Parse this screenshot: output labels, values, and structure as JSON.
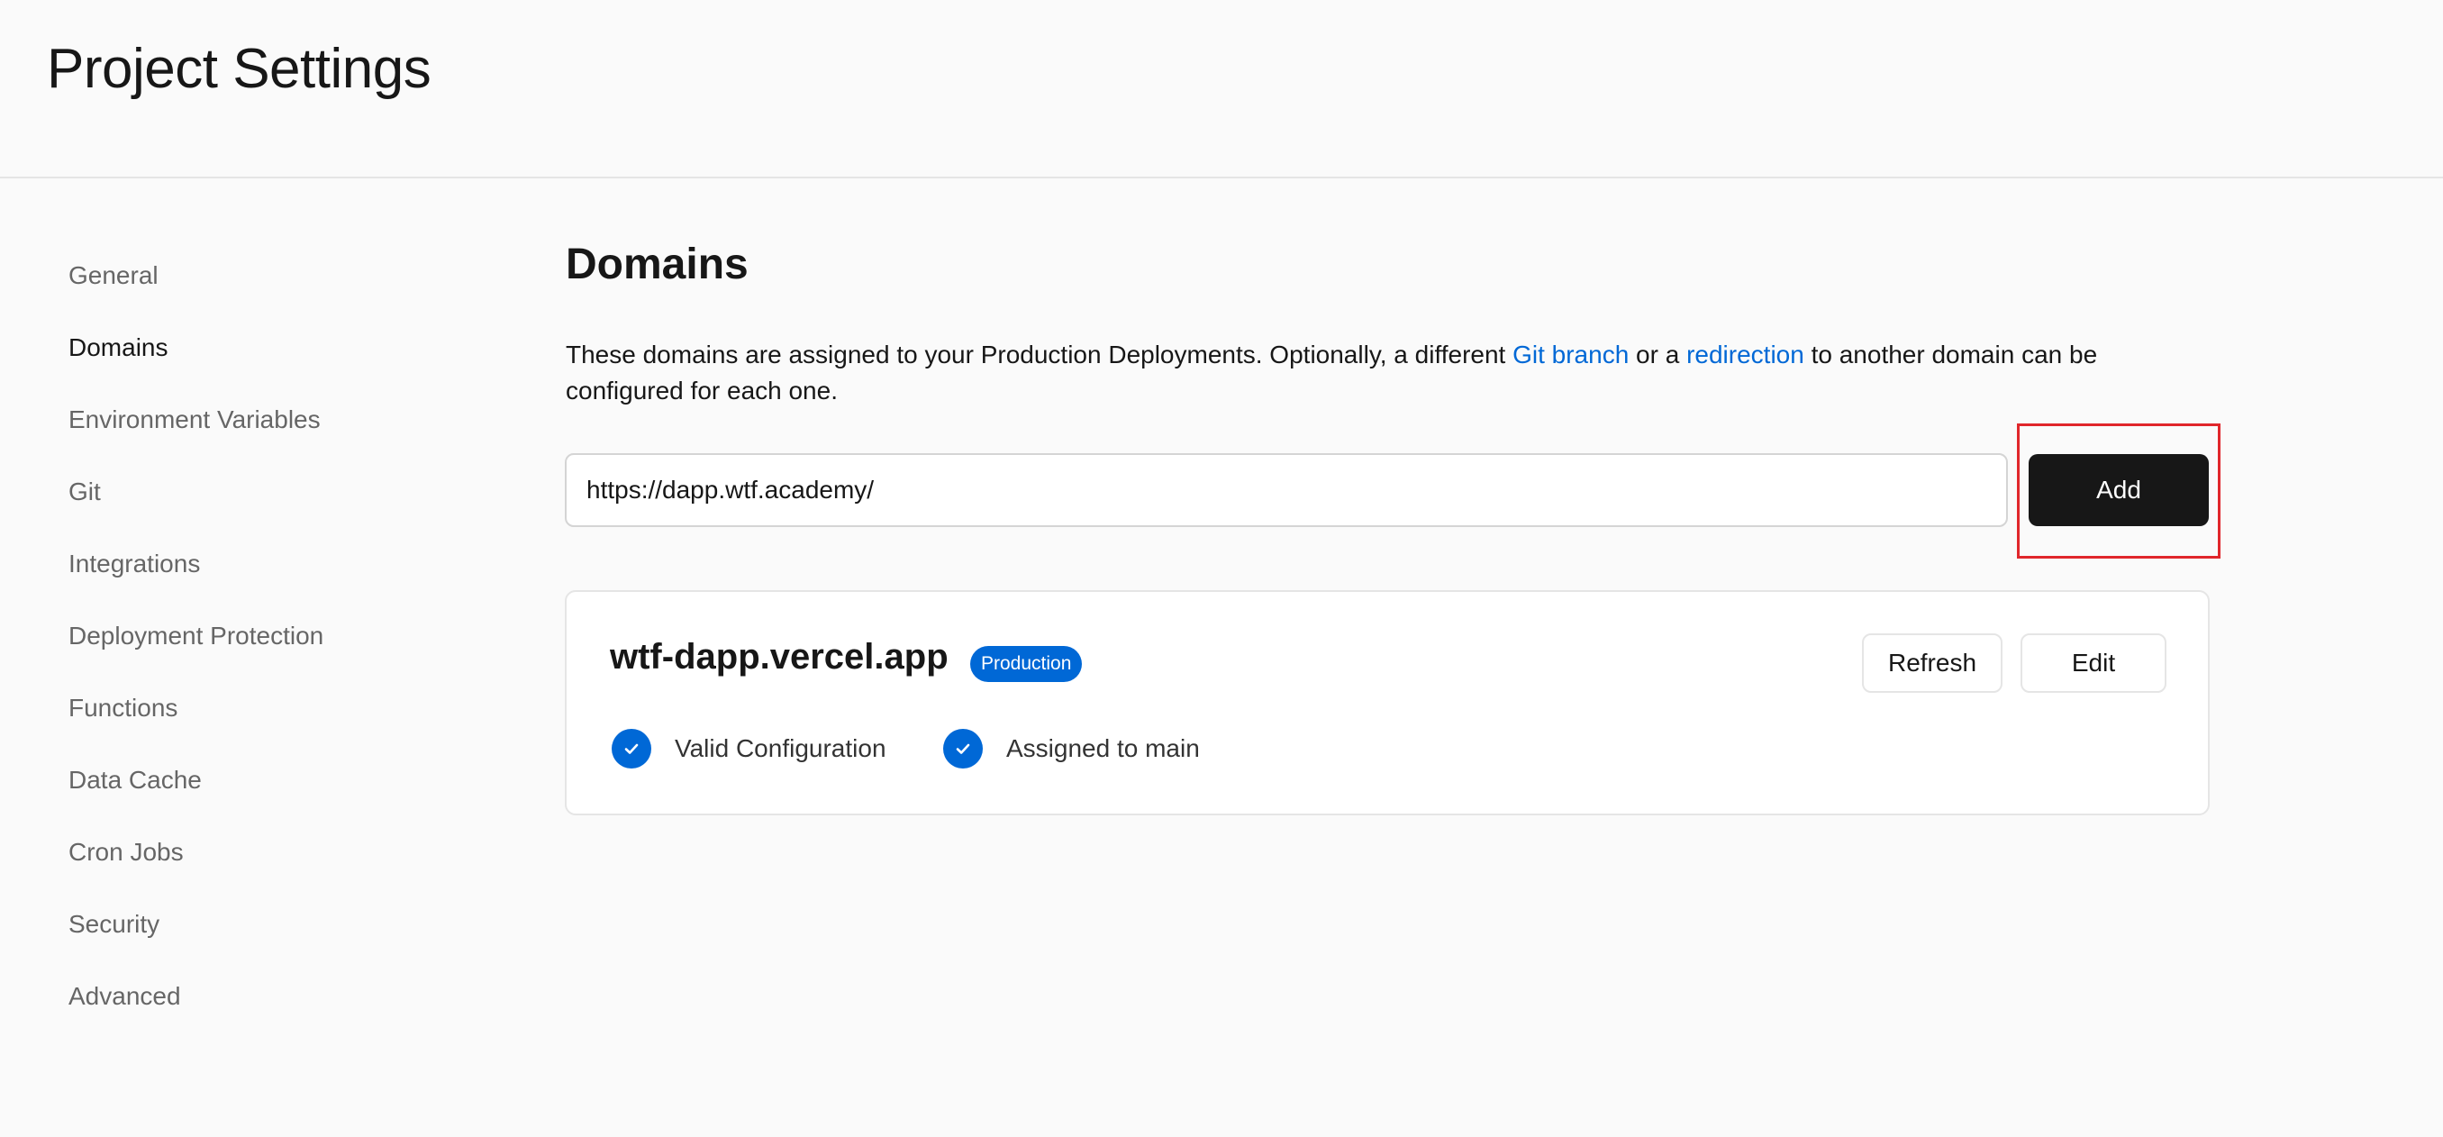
{
  "header": {
    "title": "Project Settings"
  },
  "sidebar": {
    "items": [
      {
        "label": "General"
      },
      {
        "label": "Domains",
        "active": true
      },
      {
        "label": "Environment Variables"
      },
      {
        "label": "Git"
      },
      {
        "label": "Integrations"
      },
      {
        "label": "Deployment Protection"
      },
      {
        "label": "Functions"
      },
      {
        "label": "Data Cache"
      },
      {
        "label": "Cron Jobs"
      },
      {
        "label": "Security"
      },
      {
        "label": "Advanced"
      }
    ]
  },
  "main": {
    "section_title": "Domains",
    "description": {
      "part1": "These domains are assigned to your Production Deployments. Optionally, a different ",
      "link1": "Git branch",
      "part2": " or a ",
      "link2": "redirection",
      "part3": " to another domain can be configured for each one."
    },
    "domain_input": {
      "value": "https://dapp.wtf.academy/"
    },
    "add_button_label": "Add",
    "domain_card": {
      "domain": "wtf-dapp.vercel.app",
      "badge": "Production",
      "refresh_label": "Refresh",
      "edit_label": "Edit",
      "status": [
        {
          "label": "Valid Configuration",
          "icon": "check-circle-icon"
        },
        {
          "label": "Assigned to main",
          "icon": "check-circle-icon"
        }
      ]
    }
  },
  "colors": {
    "accent": "#0068d6",
    "primary_button": "#171717",
    "highlight": "#e0262b",
    "background": "#fafafa"
  }
}
